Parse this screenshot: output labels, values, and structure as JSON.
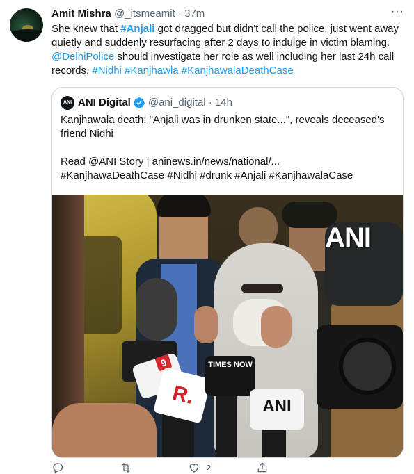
{
  "tweet": {
    "author_name": "Amit Mishra",
    "handle": "@_itsmeamit",
    "separator": "·",
    "time": "37m",
    "more_label": "···",
    "text_1": "She knew that ",
    "tag_anjali": "#Anjali",
    "text_2": " got dragged but didn't call the police, just went away quietly and suddenly resurfacing after 2 days to indulge in victim blaming. ",
    "mention_police": "@DelhiPolice",
    "text_3": " should investigate her role as well including her last 24h call records. ",
    "tag_nidhi": "#Nidhi",
    "tag_kanjhawla": "#Kanjhawla",
    "tag_case": "#KanjhawalaDeathCase"
  },
  "quote": {
    "avatar_text": "ANI",
    "author_name": "ANI Digital",
    "handle": "@ani_digital",
    "separator": "·",
    "time": "14h",
    "line_1": "Kanjhawala death: \"Anjali was in drunken state...\", reveals deceased's friend Nidhi",
    "line_2": "Read @ANI Story | aninews.in/news/national/...",
    "line_3": "#KanjhawaDeathCase #Nidhi #drunk #Anjali #KanjhawalaCase",
    "image": {
      "watermark": "ANI",
      "mic_1": "ANI",
      "mic_2": "TIMES NOW",
      "mic_3": "R.",
      "mic_4": "9"
    }
  },
  "actions": {
    "reply_count": "",
    "retweet_count": "",
    "like_count": "2"
  },
  "colors": {
    "link": "#1d9bf0",
    "muted": "#536471",
    "text": "#0f1419",
    "border": "#cfd9de"
  }
}
